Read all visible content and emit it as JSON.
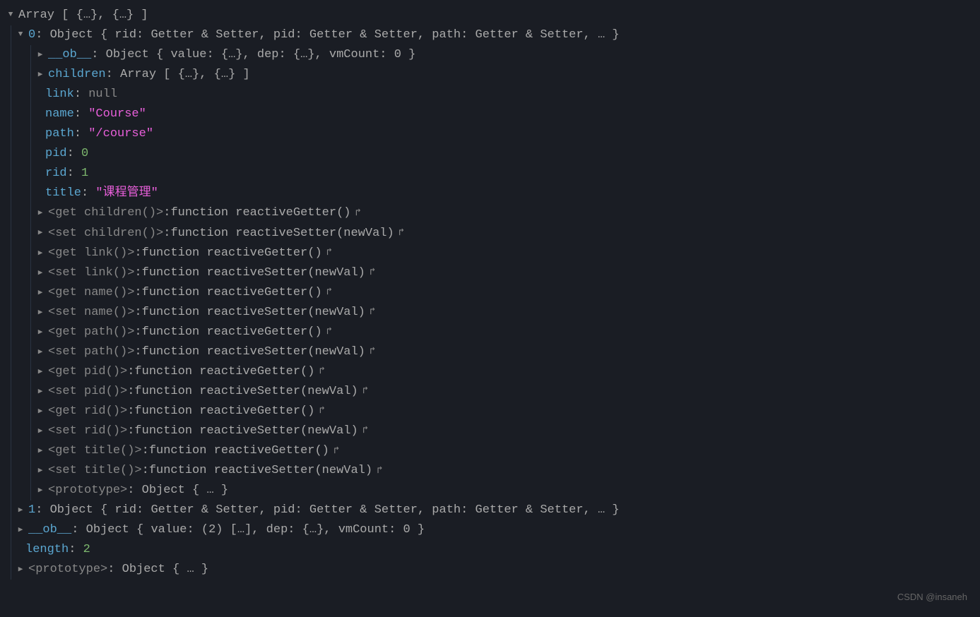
{
  "root": {
    "type": "Array",
    "preview": "[ {…}, {…} ]"
  },
  "item0": {
    "index": "0",
    "type": "Object",
    "preview": "{ rid: Getter & Setter, pid: Getter & Setter, path: Getter & Setter, … }"
  },
  "ob": {
    "key": "__ob__",
    "type": "Object",
    "preview": "{ value: {…}, dep: {…}, vmCount: 0 }"
  },
  "children": {
    "key": "children",
    "type": "Array",
    "preview": "[ {…}, {…} ]"
  },
  "props": {
    "link": {
      "key": "link",
      "value": "null"
    },
    "name": {
      "key": "name",
      "value": "\"Course\""
    },
    "path": {
      "key": "path",
      "value": "\"/course\""
    },
    "pid": {
      "key": "pid",
      "value": "0"
    },
    "rid": {
      "key": "rid",
      "value": "1"
    },
    "title": {
      "key": "title",
      "value": "\"课程管理\""
    }
  },
  "accessors": [
    {
      "label": "<get children()>",
      "fn": "function reactiveGetter()"
    },
    {
      "label": "<set children()>",
      "fn": "function reactiveSetter(newVal)"
    },
    {
      "label": "<get link()>",
      "fn": "function reactiveGetter()"
    },
    {
      "label": "<set link()>",
      "fn": "function reactiveSetter(newVal)"
    },
    {
      "label": "<get name()>",
      "fn": "function reactiveGetter()"
    },
    {
      "label": "<set name()>",
      "fn": "function reactiveSetter(newVal)"
    },
    {
      "label": "<get path()>",
      "fn": "function reactiveGetter()"
    },
    {
      "label": "<set path()>",
      "fn": "function reactiveSetter(newVal)"
    },
    {
      "label": "<get pid()>",
      "fn": "function reactiveGetter()"
    },
    {
      "label": "<set pid()>",
      "fn": "function reactiveSetter(newVal)"
    },
    {
      "label": "<get rid()>",
      "fn": "function reactiveGetter()"
    },
    {
      "label": "<set rid()>",
      "fn": "function reactiveSetter(newVal)"
    },
    {
      "label": "<get title()>",
      "fn": "function reactiveGetter()"
    },
    {
      "label": "<set title()>",
      "fn": "function reactiveSetter(newVal)"
    }
  ],
  "proto0": {
    "key": "<prototype>",
    "type": "Object",
    "preview": "{ … }"
  },
  "item1": {
    "index": "1",
    "type": "Object",
    "preview": "{ rid: Getter & Setter, pid: Getter & Setter, path: Getter & Setter, … }"
  },
  "obArr": {
    "key": "__ob__",
    "type": "Object",
    "preview": "{ value: (2) […], dep: {…}, vmCount: 0 }"
  },
  "length": {
    "key": "length",
    "value": "2"
  },
  "protoArr": {
    "key": "<prototype>",
    "type": "Object",
    "preview": "{ … }"
  },
  "watermark": "CSDN @insaneh"
}
